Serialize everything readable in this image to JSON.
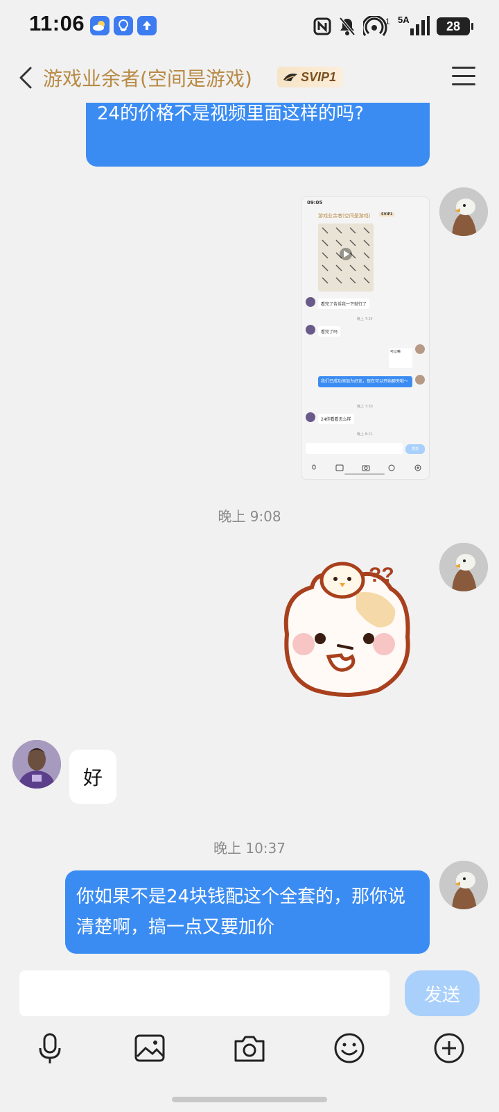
{
  "status": {
    "time": "11:06",
    "network_label": "5A",
    "battery": "28",
    "signal_label": "1"
  },
  "header": {
    "title": "游戏业余者(空间是游戏)",
    "badge": "SVIP1"
  },
  "messages": {
    "m1_text": "24的价格不是视频里面这样的吗?",
    "ts1": "晚上 9:08",
    "reply_in": "好",
    "ts2": "晚上 10:37",
    "m3_text": "你如果不是24块钱配这个全套的，那你说清楚啊，搞一点又要加价"
  },
  "nested_screenshot": {
    "time": "09:05",
    "title": "游戏业余者(空间是游戏)",
    "badge": "SVIP1",
    "msgs": [
      "看完了告诉我一下就行了",
      "晚上 7:24",
      "看完了吗",
      "我们已成功添加为好友，现在可以开始聊天啦～",
      "晚上 7:30",
      "24你看看怎么样",
      "晚上 8:21"
    ],
    "sticker_text": "可以嘛",
    "send": "发送"
  },
  "input": {
    "placeholder": "",
    "send_label": "发送"
  },
  "colors": {
    "bubble_out": "#3b8cf2",
    "title_gold": "#b88a44",
    "send_disabled": "#a8d0fb"
  }
}
